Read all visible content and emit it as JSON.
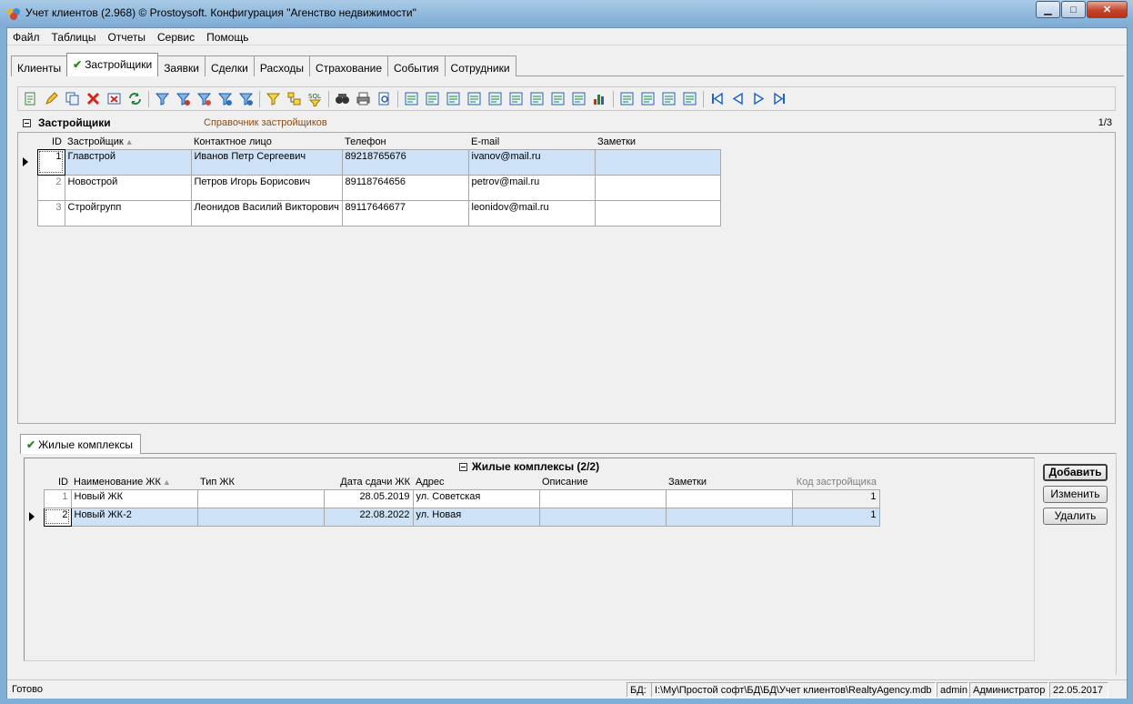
{
  "window": {
    "title": "Учет клиентов (2.968) © Prostoysoft. Конфигурация \"Агенство недвижимости\"",
    "minimize": "▁",
    "maximize": "□",
    "close": "✕"
  },
  "menu": [
    "Файл",
    "Таблицы",
    "Отчеты",
    "Сервис",
    "Помощь"
  ],
  "tabs": [
    {
      "label": "Клиенты",
      "active": false
    },
    {
      "label": "Застройщики",
      "active": true
    },
    {
      "label": "Заявки",
      "active": false
    },
    {
      "label": "Сделки",
      "active": false
    },
    {
      "label": "Расходы",
      "active": false
    },
    {
      "label": "Страхование",
      "active": false
    },
    {
      "label": "События",
      "active": false
    },
    {
      "label": "Сотрудники",
      "active": false
    }
  ],
  "check_mark": "✔",
  "toolbar_icons": [
    "new-record-icon",
    "edit-icon",
    "copy-icon",
    "delete-icon",
    "delete-all-icon",
    "refresh-icon",
    "|",
    "filter-icon",
    "filter-remove-icon",
    "filter-clear-icon",
    "filter-advanced-icon",
    "filter-saved-icon",
    "|",
    "sort-icon",
    "group-icon",
    "sql-icon",
    "|",
    "find-icon",
    "print-icon",
    "print-preview-icon",
    "|",
    "export-icon",
    "import-icon",
    "export-word-icon",
    "export-word2-icon",
    "export-excel-icon",
    "export-excel2-icon",
    "export-csv-icon",
    "export-txt-icon",
    "export-xml-icon",
    "chart-icon",
    "|",
    "column-settings-icon",
    "form-settings-icon",
    "table-settings-icon",
    "report-settings-icon",
    "|",
    "first-record-icon",
    "prev-record-icon",
    "next-record-icon",
    "last-record-icon"
  ],
  "main_panel": {
    "title": "Застройщики",
    "subtitle": "Справочник застройщиков",
    "count": "1/3",
    "columns": [
      "ID",
      "Застройщик",
      "Контактное лицо",
      "Телефон",
      "E-mail",
      "Заметки"
    ],
    "sort_mark": "▲",
    "rows": [
      {
        "id": "1",
        "name": "Главстрой",
        "contact": "Иванов Петр Сергеевич",
        "phone": "89218765676",
        "email": "ivanov@mail.ru",
        "notes": "",
        "selected": true
      },
      {
        "id": "2",
        "name": "Новострой",
        "contact": "Петров Игорь Борисович",
        "phone": "89118764656",
        "email": "petrov@mail.ru",
        "notes": "",
        "selected": false
      },
      {
        "id": "3",
        "name": "Стройгрупп",
        "contact": "Леонидов Василий Викторович",
        "phone": "89117646677",
        "email": "leonidov@mail.ru",
        "notes": "",
        "selected": false
      }
    ]
  },
  "sub_tab": {
    "label": "Жилые комплексы"
  },
  "sub_panel": {
    "title": "Жилые комплексы (2/2)",
    "columns": [
      "ID",
      "Наименование ЖК",
      "Тип ЖК",
      "Дата сдачи ЖК",
      "Адрес",
      "Описание",
      "Заметки",
      "Код застройщика"
    ],
    "rows": [
      {
        "id": "1",
        "name": "Новый ЖК",
        "type": "",
        "date": "28.05.2019",
        "address": "ул. Советская",
        "desc": "",
        "notes": "",
        "dev_code": "1",
        "selected": false
      },
      {
        "id": "2",
        "name": "Новый ЖК-2",
        "type": "",
        "date": "22.08.2022",
        "address": "ул. Новая",
        "desc": "",
        "notes": "",
        "dev_code": "1",
        "selected": true
      }
    ],
    "buttons": {
      "add": "Добавить",
      "edit": "Изменить",
      "delete": "Удалить"
    }
  },
  "status": {
    "ready": "Готово",
    "db_label": "БД:",
    "db_path": "I:\\My\\Простой софт\\БД\\БД\\Учет клиентов\\RealtyAgency.mdb",
    "user": "admin",
    "role": "Администратор",
    "date": "22.05.2017"
  },
  "colors": {
    "accent": "#cde1f7",
    "check": "#2a8a1e",
    "subtitle": "#8a4d1a"
  }
}
